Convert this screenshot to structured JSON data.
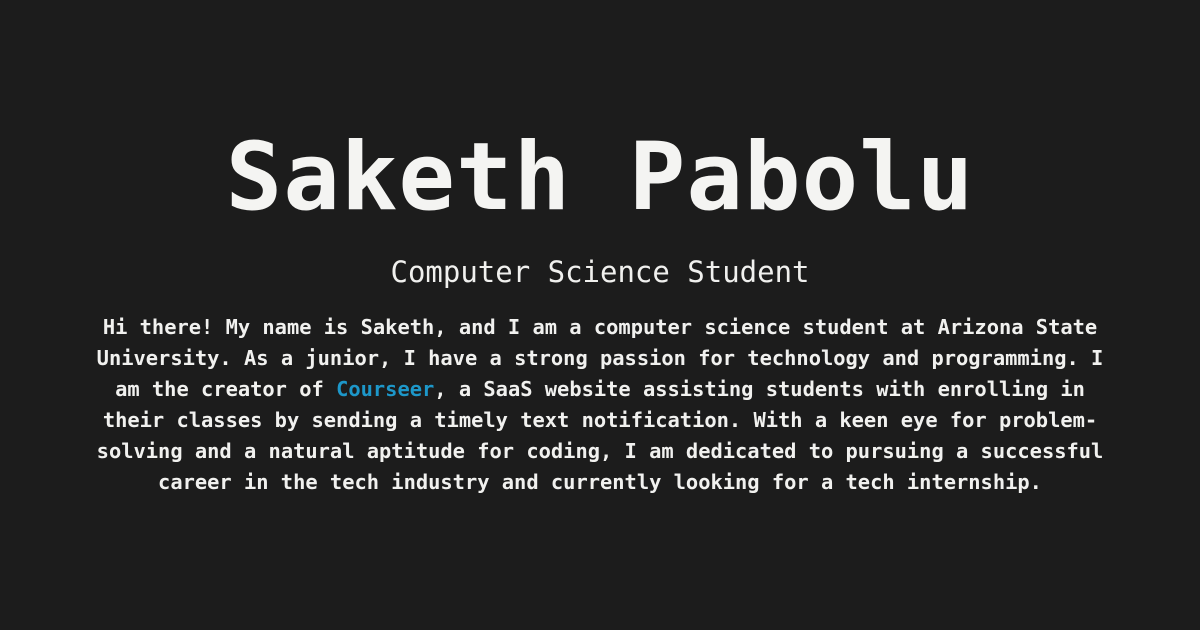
{
  "hero": {
    "name": "Saketh Pabolu",
    "subtitle": "Computer Science Student",
    "bio_before_link": "Hi there! My name is Saketh, and I am a computer science student at Arizona State University. As a junior, I have a strong passion for technology and programming. I am the creator of ",
    "bio_link_text": "Courseer",
    "bio_after_link": ", a SaaS website assisting students with enrolling in their classes by sending a timely text notification. With a keen eye for problem-solving and a natural aptitude for coding, I am dedicated to pursuing a successful career in the tech industry and currently looking for a tech internship."
  },
  "colors": {
    "background": "#1c1c1c",
    "text": "#f3f3f1",
    "link": "#1d97c9"
  }
}
